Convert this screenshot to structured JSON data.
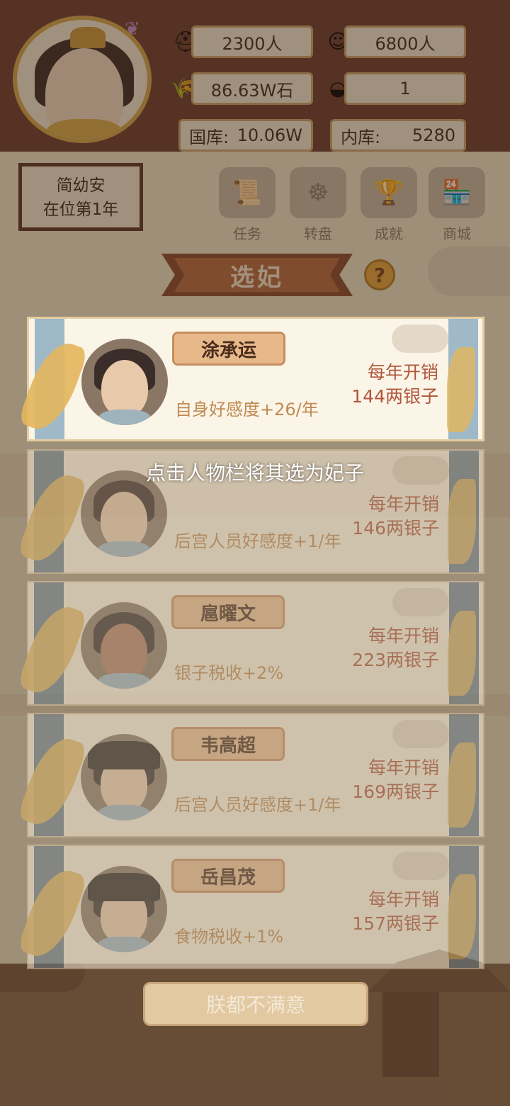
{
  "stats": {
    "soldiers": "2300人",
    "population": "6800人",
    "food": "86.63W石",
    "gold_ingot": "1",
    "treasury_label": "国库:",
    "treasury_value": "10.06W",
    "inner_label": "内库:",
    "inner_value": "5280"
  },
  "ruler": {
    "name": "简幼安",
    "reign": "在位第1年"
  },
  "features": [
    {
      "label": "任务",
      "icon": "scroll-icon"
    },
    {
      "label": "转盘",
      "icon": "wheel-icon"
    },
    {
      "label": "成就",
      "icon": "trophy-icon"
    },
    {
      "label": "商城",
      "icon": "shop-icon"
    }
  ],
  "title": "选妃",
  "help_label": "?",
  "hint": "点击人物栏将其选为妃子",
  "candidates": [
    {
      "name": "涂承运",
      "effect": "自身好感度+26/年",
      "cost_label": "每年开销",
      "cost_value": "144两银子"
    },
    {
      "name": "",
      "effect": "后宫人员好感度+1/年",
      "cost_label": "每年开销",
      "cost_value": "146两银子"
    },
    {
      "name": "扈曜文",
      "effect": "银子税收+2%",
      "cost_label": "每年开销",
      "cost_value": "223两银子"
    },
    {
      "name": "韦高超",
      "effect": "后宫人员好感度+1/年",
      "cost_label": "每年开销",
      "cost_value": "169两银子"
    },
    {
      "name": "岳昌茂",
      "effect": "食物税收+1%",
      "cost_label": "每年开销",
      "cost_value": "157两银子"
    }
  ],
  "bottom_button": "朕都不满意",
  "colors": {
    "accent_brown": "#6b3b2c",
    "cost_red": "#b0563b",
    "effect_orange": "#c08a52",
    "ribbon": "#b76a3e"
  }
}
